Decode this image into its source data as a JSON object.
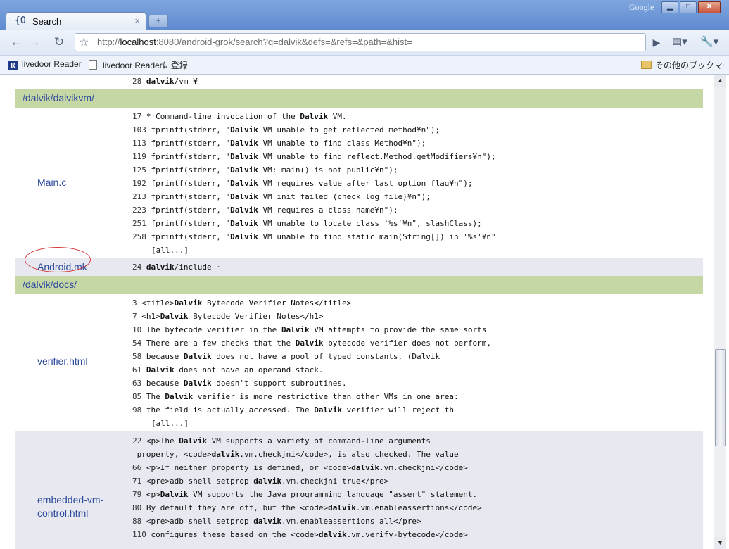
{
  "browser": {
    "tab_title": "Search",
    "tab_favicon": "{O",
    "tab_close": "×",
    "new_tab": "+",
    "brand": "Google",
    "url_scheme": "http://",
    "url_host": "localhost",
    "url_rest": ":8080/android-grok/search?q=dalvik&defs=&refs=&path=&hist=",
    "window_min": "▁",
    "window_max": "□",
    "window_close": "✕",
    "back": "←",
    "forward": "→",
    "reload": "↻",
    "star": "☆",
    "go": "▶",
    "page_menu": "▤▾",
    "wrench_menu": "🔧▾"
  },
  "bookmarks": {
    "item1": "livedoor Reader",
    "item1_icon": "R",
    "item2": "livedoor Readerに登録",
    "other": "その他のブックマーク"
  },
  "results": {
    "top_hit": {
      "ln": "28",
      "pre": "",
      "bold": "dalvik",
      "post": "/vm ¥"
    },
    "dir1": "/dalvik/dalvikvm/",
    "main_c": {
      "file": "Main.c",
      "hits": [
        {
          "ln": "17",
          "pre": "* Command-line invocation of the ",
          "bold": "Dalvik",
          "post": " VM."
        },
        {
          "ln": "103",
          "pre": "fprintf(stderr, \"",
          "bold": "Dalvik",
          "post": " VM unable to get reflected method¥n\");"
        },
        {
          "ln": "113",
          "pre": "fprintf(stderr, \"",
          "bold": "Dalvik",
          "post": " VM unable to find class Method¥n\");"
        },
        {
          "ln": "119",
          "pre": "fprintf(stderr, \"",
          "bold": "Dalvik",
          "post": " VM unable to find reflect.Method.getModifiers¥n\");"
        },
        {
          "ln": "125",
          "pre": "fprintf(stderr, \"",
          "bold": "Dalvik",
          "post": " VM: main() is not public¥n\");"
        },
        {
          "ln": "192",
          "pre": "fprintf(stderr, \"",
          "bold": "Dalvik",
          "post": " VM requires value after last option flag¥n\");"
        },
        {
          "ln": "213",
          "pre": "fprintf(stderr, \"",
          "bold": "Dalvik",
          "post": " VM init failed (check log file)¥n\");"
        },
        {
          "ln": "223",
          "pre": "fprintf(stderr, \"",
          "bold": "Dalvik",
          "post": " VM requires a class name¥n\");"
        },
        {
          "ln": "251",
          "pre": "fprintf(stderr, \"",
          "bold": "Dalvik",
          "post": " VM unable to locate class '%s'¥n\", slashClass);"
        },
        {
          "ln": "258",
          "pre": "fprintf(stderr, \"",
          "bold": "Dalvik",
          "post": " VM unable to find static main(String[]) in '%s'¥n\""
        }
      ],
      "more": "[all...]"
    },
    "android_mk": {
      "file": "Android.mk",
      "hits": [
        {
          "ln": "24",
          "pre": "",
          "bold": "dalvik",
          "post": "/include ·"
        }
      ]
    },
    "dir2": "/dalvik/docs/",
    "verifier": {
      "file": "verifier.html",
      "hits": [
        {
          "ln": "3",
          "pre": "<title>",
          "bold": "Dalvik",
          "post": " Bytecode Verifier Notes</title>"
        },
        {
          "ln": "7",
          "pre": "<h1>",
          "bold": "Dalvik",
          "post": " Bytecode Verifier Notes</h1>"
        },
        {
          "ln": "10",
          "pre": "The bytecode verifier in the ",
          "bold": "Dalvik",
          "post": " VM attempts to provide the same sorts"
        },
        {
          "ln": "54",
          "pre": "There are a few checks that the ",
          "bold": "Dalvik",
          "post": " bytecode verifier does not perform,"
        },
        {
          "ln": "58",
          "pre": "because ",
          "bold": "Dalvik",
          "post": " does not have a pool of typed constants. (Dalvik"
        },
        {
          "ln": "61",
          "pre": "",
          "bold": "Dalvik",
          "post": " does not have an operand stack."
        },
        {
          "ln": "63",
          "pre": "because ",
          "bold": "Dalvik",
          "post": " doesn't support subroutines."
        },
        {
          "ln": "85",
          "pre": "The ",
          "bold": "Dalvik",
          "post": " verifier is more restrictive than other VMs in one area:"
        },
        {
          "ln": "98",
          "pre": "the field is actually accessed. The ",
          "bold": "Dalvik",
          "post": " verifier will reject th"
        }
      ],
      "more": "[all...]"
    },
    "embedded": {
      "file_line1": "embedded-vm-",
      "file_line2": "control.html",
      "hits": [
        {
          "ln": "22",
          "pre": "<p>The ",
          "bold": "Dalvik",
          "post": " VM supports a variety of command-line arguments"
        },
        {
          "ln": "",
          "pre": "property, <code>",
          "bold": "dalvik",
          "post": ".vm.checkjni</code>, is also checked. The value"
        },
        {
          "ln": "66",
          "pre": "<p>If neither property is defined, or <code>",
          "bold": "dalvik",
          "post": ".vm.checkjni</code>"
        },
        {
          "ln": "71",
          "pre": "<pre>adb shell setprop ",
          "bold": "dalvik",
          "post": ".vm.checkjni true</pre>"
        },
        {
          "ln": "79",
          "pre": "<p>",
          "bold": "Dalvik",
          "post": " VM supports the Java programming language \"assert\" statement."
        },
        {
          "ln": "80",
          "pre": "By default they are off, but the <code>",
          "bold": "dalvik",
          "post": ".vm.enableassertions</code>"
        },
        {
          "ln": "88",
          "pre": "<pre>adb shell setprop ",
          "bold": "dalvik",
          "post": ".vm.enableassertions all</pre>"
        },
        {
          "ln": "110",
          "pre": "configures these based on the <code>",
          "bold": "dalvik",
          "post": ".vm.verify-bytecode</code>"
        }
      ]
    }
  }
}
